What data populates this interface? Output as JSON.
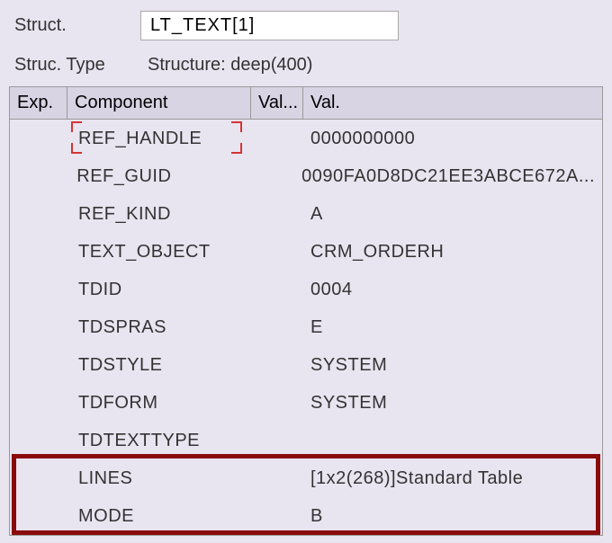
{
  "header": {
    "struct_label": "Struct.",
    "struct_value": "LT_TEXT[1]",
    "struc_type_label": "Struc. Type",
    "struc_type_value": "Structure: deep(400)"
  },
  "columns": {
    "exp": "Exp.",
    "component": "Component",
    "val1": "Val...",
    "val2": "Val."
  },
  "rows": [
    {
      "component": "REF_HANDLE",
      "value": "0000000000"
    },
    {
      "component": "REF_GUID",
      "value": "0090FA0D8DC21EE3ABCE672A..."
    },
    {
      "component": "REF_KIND",
      "value": "A"
    },
    {
      "component": "TEXT_OBJECT",
      "value": "CRM_ORDERH"
    },
    {
      "component": "TDID",
      "value": "0004"
    },
    {
      "component": "TDSPRAS",
      "value": "E"
    },
    {
      "component": "TDSTYLE",
      "value": "SYSTEM"
    },
    {
      "component": "TDFORM",
      "value": "SYSTEM"
    },
    {
      "component": "TDTEXTTYPE",
      "value": ""
    },
    {
      "component": "LINES",
      "value": "[1x2(268)]Standard Table"
    },
    {
      "component": "MODE",
      "value": "B"
    }
  ]
}
